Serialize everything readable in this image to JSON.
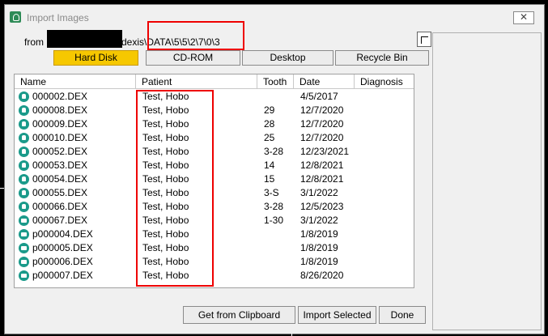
{
  "window": {
    "title": "Import Images",
    "close_glyph": "✕",
    "icon": "app-logo-icon"
  },
  "path": {
    "label": "from",
    "value": "dexis\\DATA\\5\\5\\2\\7\\0\\3"
  },
  "locations": [
    "Hard Disk",
    "CD-ROM",
    "Desktop",
    "Recycle Bin"
  ],
  "columns": [
    "Name",
    "Patient",
    "Tooth",
    "Date",
    "Diagnosis"
  ],
  "files": [
    {
      "icon": "xray-icon",
      "name": "000002.DEX",
      "patient": "Test, Hobo",
      "tooth": "",
      "date": "4/5/2017"
    },
    {
      "icon": "tooth-icon",
      "name": "000008.DEX",
      "patient": "Test, Hobo",
      "tooth": "29",
      "date": "12/7/2020"
    },
    {
      "icon": "tooth-icon",
      "name": "000009.DEX",
      "patient": "Test, Hobo",
      "tooth": "28",
      "date": "12/7/2020"
    },
    {
      "icon": "tooth-icon",
      "name": "000010.DEX",
      "patient": "Test, Hobo",
      "tooth": "25",
      "date": "12/7/2020"
    },
    {
      "icon": "tooth-icon",
      "name": "000052.DEX",
      "patient": "Test, Hobo",
      "tooth": "3-28",
      "date": "12/23/2021"
    },
    {
      "icon": "tooth-icon",
      "name": "000053.DEX",
      "patient": "Test, Hobo",
      "tooth": "14",
      "date": "12/8/2021"
    },
    {
      "icon": "tooth-icon",
      "name": "000054.DEX",
      "patient": "Test, Hobo",
      "tooth": "15",
      "date": "12/8/2021"
    },
    {
      "icon": "tooth-icon",
      "name": "000055.DEX",
      "patient": "Test, Hobo",
      "tooth": "3-S",
      "date": "3/1/2022"
    },
    {
      "icon": "tooth-icon",
      "name": "000066.DEX",
      "patient": "Test, Hobo",
      "tooth": "3-28",
      "date": "12/5/2023"
    },
    {
      "icon": "camera-icon",
      "name": "000067.DEX",
      "patient": "Test, Hobo",
      "tooth": "1-30",
      "date": "3/1/2022"
    },
    {
      "icon": "camera-icon",
      "name": "p000004.DEX",
      "patient": "Test, Hobo",
      "tooth": "",
      "date": "1/8/2019"
    },
    {
      "icon": "camera-icon",
      "name": "p000005.DEX",
      "patient": "Test, Hobo",
      "tooth": "",
      "date": "1/8/2019"
    },
    {
      "icon": "camera-icon",
      "name": "p000006.DEX",
      "patient": "Test, Hobo",
      "tooth": "",
      "date": "1/8/2019"
    },
    {
      "icon": "camera-icon",
      "name": "p000007.DEX",
      "patient": "Test, Hobo",
      "tooth": "",
      "date": "8/26/2020"
    }
  ],
  "buttons": {
    "clipboard": "Get from Clipboard",
    "import": "Import Selected",
    "done": "Done"
  },
  "colors": {
    "active_location": "#f6c800",
    "file_icon": "#1a9a8a",
    "highlight": "#e00000"
  }
}
